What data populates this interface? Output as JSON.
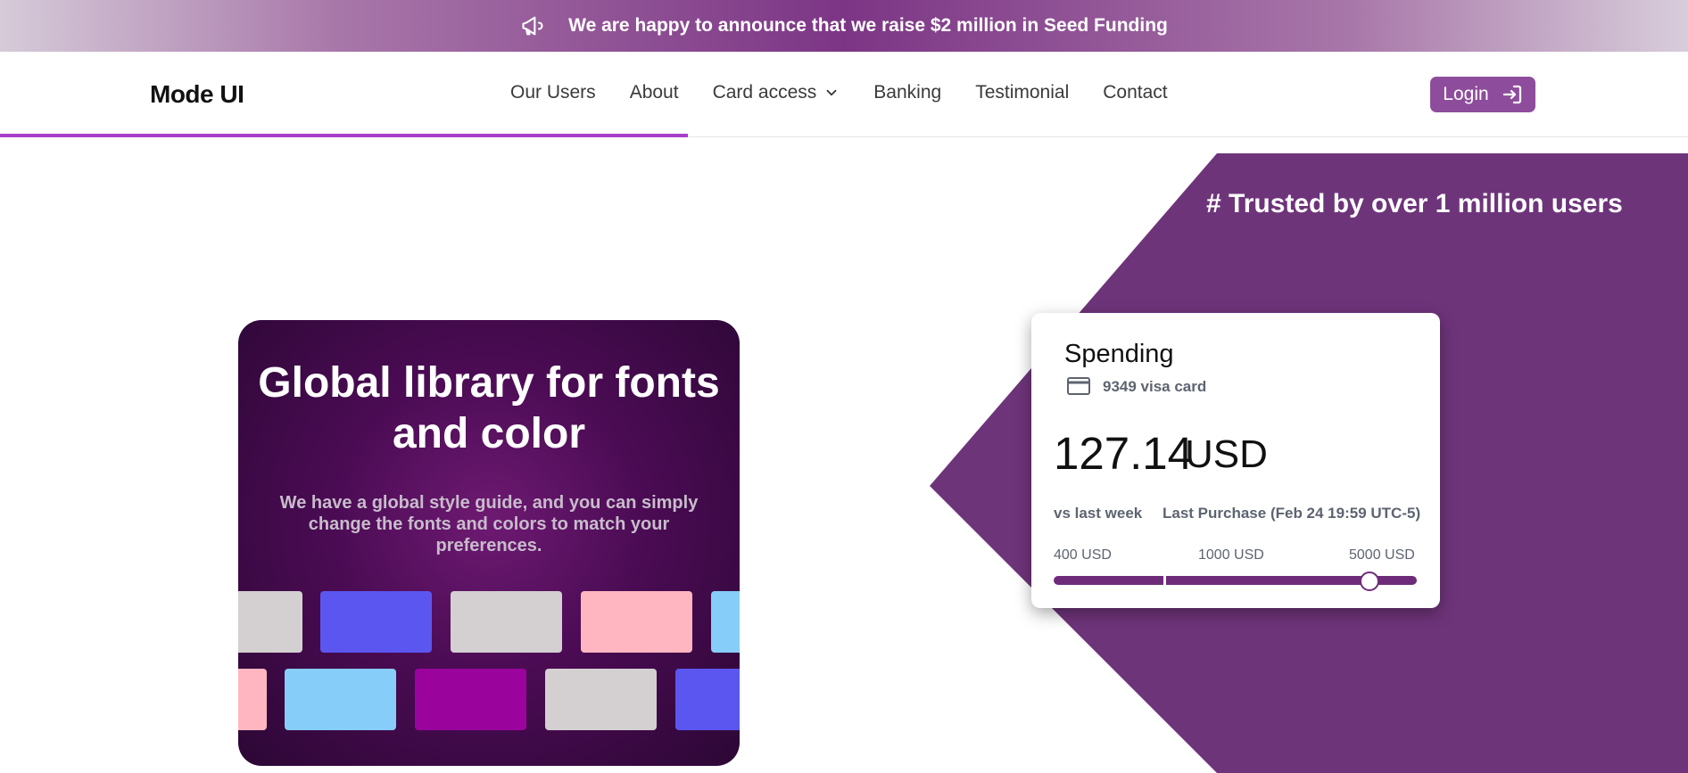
{
  "announcement": {
    "icon": "megaphone-icon",
    "text": "We are happy to announce that we raise $2 million in Seed Funding"
  },
  "header": {
    "logo": "Mode UI",
    "nav": [
      {
        "label": "Our Users"
      },
      {
        "label": "About"
      },
      {
        "label": "Card access",
        "has_dropdown": true
      },
      {
        "label": "Banking"
      },
      {
        "label": "Testimonial"
      },
      {
        "label": "Contact"
      }
    ],
    "login_label": "Login",
    "login_icon": "sign-in-icon"
  },
  "hero": {
    "trusted_text": "# Trusted by over 1 million users"
  },
  "promo": {
    "title": "Global library for fonts and color",
    "subtitle": "We have a global style guide, and you can simply change the fonts and colors to match your preferences.",
    "swatch_colors_row1": [
      "#d4d0d1",
      "#5b56f0",
      "#d4d0d1",
      "#ffb6c1",
      "#87cdf9"
    ],
    "swatch_colors_row2": [
      "#ffb6c1",
      "#87cdf9",
      "#9a049d",
      "#d4d0d1",
      "#5b56f0"
    ]
  },
  "spending": {
    "title": "Spending",
    "card_icon": "credit-card-icon",
    "card_label": "9349 visa card",
    "amount": "127.14",
    "currency": "USD",
    "vs_label": "vs last week",
    "last_purchase": "Last Purchase (Feb 24 19:59 UTC-5)",
    "slider_ticks": [
      "400 USD",
      "1000 USD",
      "5000 USD"
    ],
    "slider_position": 0.87
  },
  "colors": {
    "brand_purple": "#6e2b79",
    "button_purple": "#8e4d9c",
    "progress_accent": "#a63ec9"
  }
}
